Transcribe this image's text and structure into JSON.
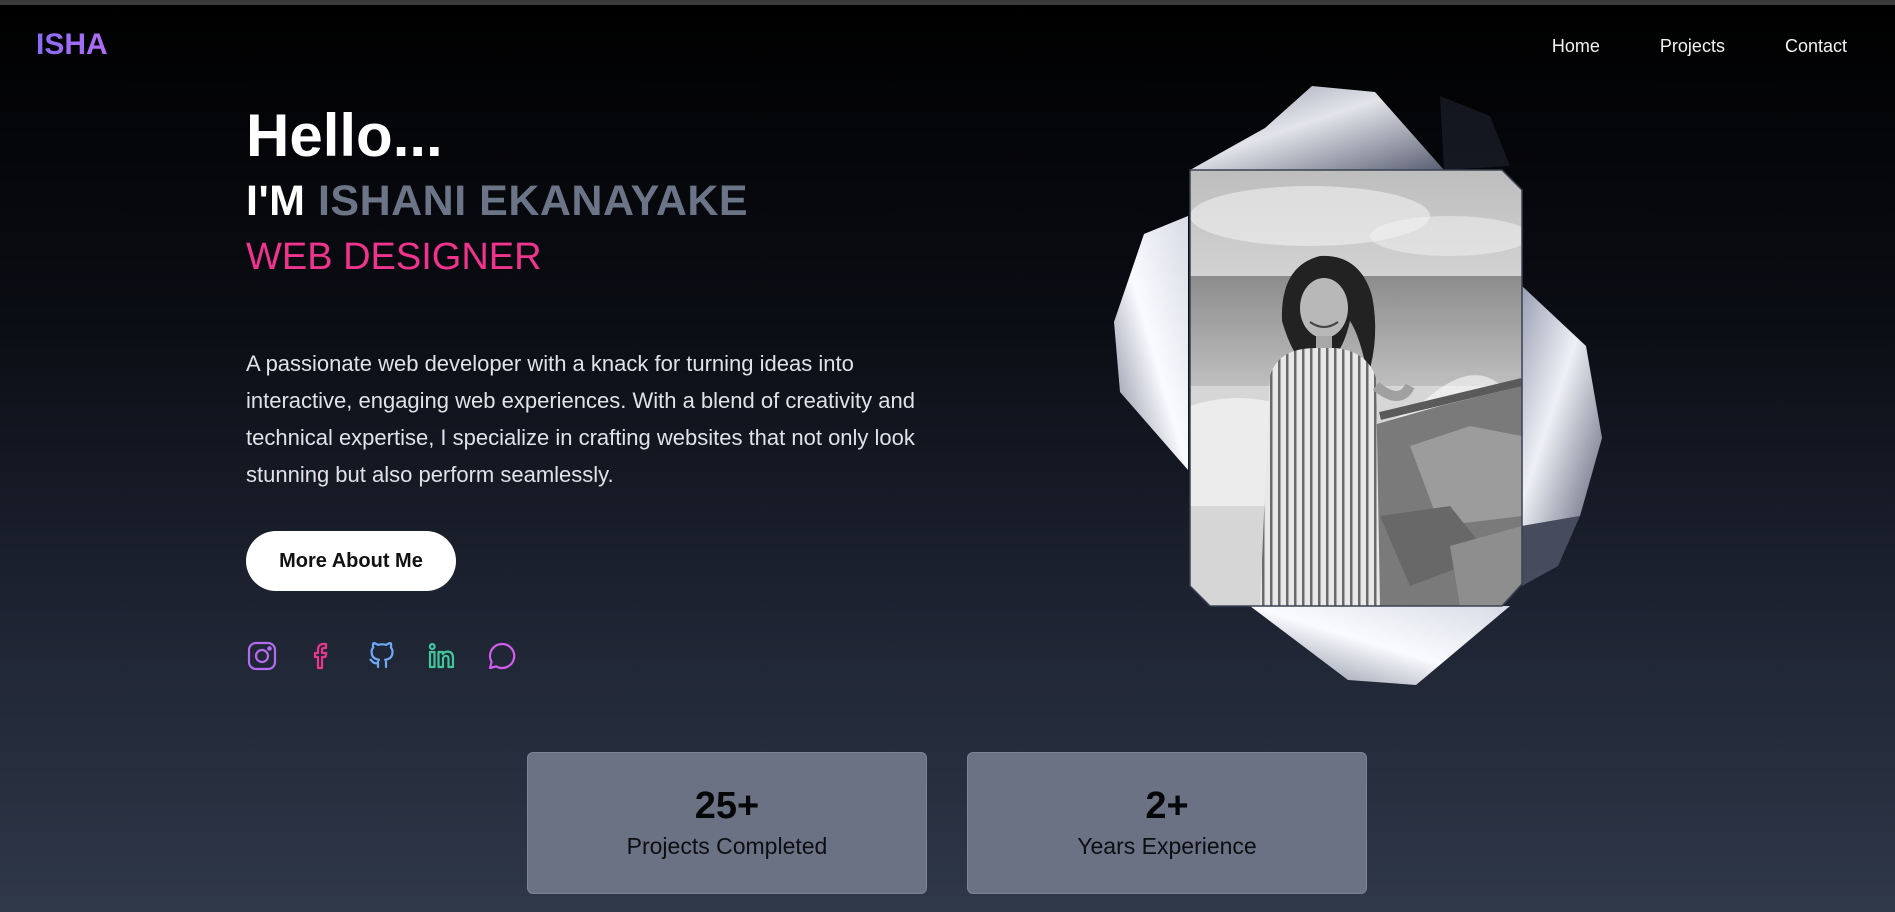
{
  "brand": {
    "logo": "ISHA"
  },
  "nav": {
    "items": [
      "Home",
      "Projects",
      "Contact"
    ]
  },
  "hero": {
    "greeting": "Hello...",
    "intro_prefix": "I'M",
    "name": "ISHANI EKANAYAKE",
    "role": "WEB DESIGNER",
    "bio": "A passionate web developer with a knack for turning ideas into interactive, engaging web experiences. With a blend of creativity and technical expertise, I specialize in crafting websites that not only look stunning but also perform seamlessly.",
    "cta_label": "More About Me"
  },
  "socials": [
    {
      "icon": "instagram-icon",
      "color": "#b36bf0"
    },
    {
      "icon": "facebook-icon",
      "color": "#e8368f"
    },
    {
      "icon": "github-icon",
      "color": "#6fa8f5"
    },
    {
      "icon": "linkedin-icon",
      "color": "#3fc79a"
    },
    {
      "icon": "chat-icon",
      "color": "#d45cf0"
    }
  ],
  "stats": [
    {
      "value": "25+",
      "label": "Projects Completed"
    },
    {
      "value": "2+",
      "label": "Years Experience"
    }
  ],
  "colors": {
    "accent_pink": "#f0348e",
    "name_gray": "#6b7587",
    "logo_purple": "#8b6cf5",
    "stat_card": "#6b7283"
  }
}
